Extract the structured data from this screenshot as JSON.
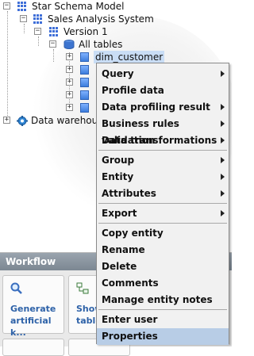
{
  "tree": {
    "root": "Star Schema Model",
    "system": "Sales Analysis System",
    "version": "Version 1",
    "all_tables": "All tables",
    "selected_table": "dim_customer",
    "warehouse": "Data warehous"
  },
  "workflow": {
    "title": "Workflow",
    "card1_line1": "Generate",
    "card1_line2": "artificial k...",
    "card2_line1": "Show",
    "card2_line2": "table"
  },
  "context_menu": {
    "groups": [
      [
        {
          "label": "Query",
          "submenu": true
        },
        {
          "label": "Profile data",
          "submenu": false
        },
        {
          "label": "Data profiling result",
          "submenu": true
        },
        {
          "label": "Business rules validation",
          "submenu": true
        },
        {
          "label": "Data transformations",
          "submenu": true
        }
      ],
      [
        {
          "label": "Group",
          "submenu": true
        },
        {
          "label": "Entity",
          "submenu": true
        },
        {
          "label": "Attributes",
          "submenu": true
        }
      ],
      [
        {
          "label": "Export",
          "submenu": true
        }
      ],
      [
        {
          "label": "Copy entity",
          "submenu": false
        },
        {
          "label": "Rename",
          "submenu": false
        },
        {
          "label": "Delete",
          "submenu": false
        },
        {
          "label": "Comments",
          "submenu": false
        },
        {
          "label": "Manage entity notes",
          "submenu": false
        }
      ],
      [
        {
          "label": "Enter user documentation",
          "submenu": false
        },
        {
          "label": "Properties",
          "submenu": false,
          "highlighted": true
        }
      ]
    ]
  },
  "colors": {
    "menu_bg": "#f1f1f1",
    "highlight": "#b8cde6",
    "tree_icon_blue": "#3f6fd8",
    "workflow_link": "#2e62a8"
  }
}
